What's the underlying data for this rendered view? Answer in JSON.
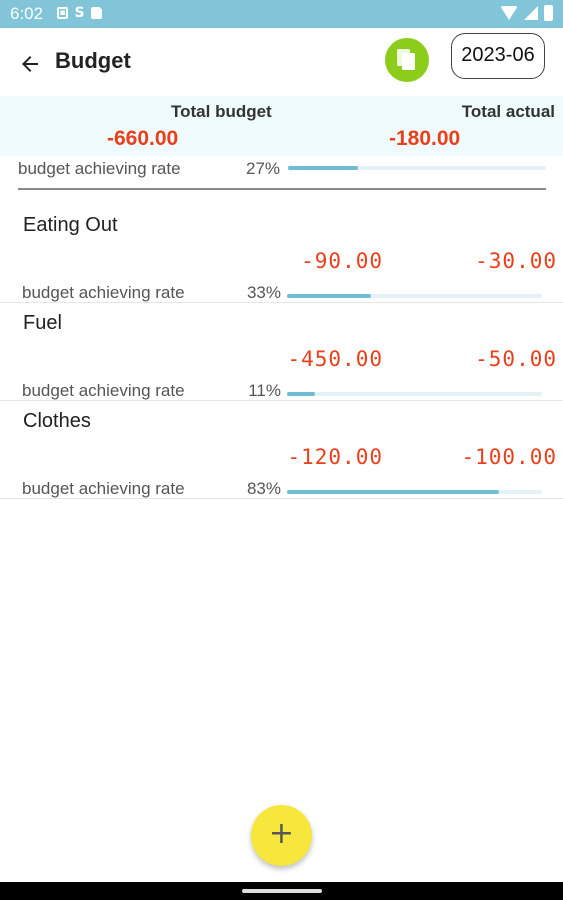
{
  "status_bar": {
    "time": "6:02",
    "icons": [
      "notification-icon",
      "s-icon",
      "sd-card-icon",
      "wifi-icon",
      "cell-signal-icon",
      "battery-icon"
    ]
  },
  "app_bar": {
    "title": "Budget",
    "month": "2023-06",
    "copy_icon": "copy-icon",
    "back_icon": "arrow-back-icon"
  },
  "summary": {
    "total_budget_label": "Total budget",
    "total_actual_label": "Total actual",
    "total_budget": "-660.00",
    "total_actual": "-180.00",
    "rate_label": "budget achieving rate",
    "rate_pct": "27%",
    "rate_fraction": 0.27
  },
  "items": [
    {
      "name": "Eating Out",
      "budget": "-90.00",
      "actual": "-30.00",
      "rate_label": "budget achieving rate",
      "rate_pct": "33%",
      "rate_fraction": 0.33
    },
    {
      "name": "Fuel",
      "budget": "-450.00",
      "actual": "-50.00",
      "rate_label": "budget achieving rate",
      "rate_pct": "11%",
      "rate_fraction": 0.11
    },
    {
      "name": "Clothes",
      "budget": "-120.00",
      "actual": "-100.00",
      "rate_label": "budget achieving rate",
      "rate_pct": "83%",
      "rate_fraction": 0.83
    }
  ],
  "fab": {
    "label": "+"
  },
  "colors": {
    "status_bar": "#82c4d8",
    "accent_negative": "#e8401c",
    "copy_button": "#8ccc1a",
    "fab": "#f7e63c",
    "progress": "#6fbdd0",
    "totals_bg": "#effbfc"
  }
}
